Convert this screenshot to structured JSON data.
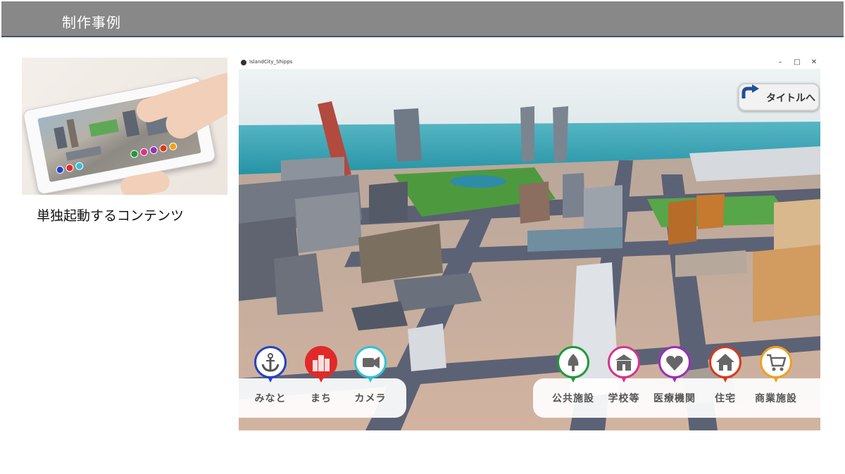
{
  "header": {
    "title": "制作事例"
  },
  "left": {
    "caption": "単独起動するコンテンツ"
  },
  "window": {
    "title": "IslandCity_Shipps",
    "controls": {
      "minimize": "–",
      "maximize": "□",
      "close": "✕"
    }
  },
  "app": {
    "title_button": "タイトルへ",
    "left_menu": [
      {
        "label": "みなと",
        "color": "#2442c8",
        "icon": "anchor-icon"
      },
      {
        "label": "まち",
        "color": "#e02a2a",
        "icon": "city-buildings-icon"
      },
      {
        "label": "カメラ",
        "color": "#2ec4d8",
        "icon": "camera-icon"
      }
    ],
    "right_menu": [
      {
        "label": "公共施設",
        "color": "#1e9a3a",
        "icon": "tree-icon"
      },
      {
        "label": "学校等",
        "color": "#d8338c",
        "icon": "school-icon"
      },
      {
        "label": "医療機関",
        "color": "#9b2fb8",
        "icon": "heart-icon"
      },
      {
        "label": "住宅",
        "color": "#d93a1c",
        "icon": "house-icon"
      },
      {
        "label": "商業施設",
        "color": "#f0a020",
        "icon": "shopping-cart-icon"
      }
    ]
  }
}
